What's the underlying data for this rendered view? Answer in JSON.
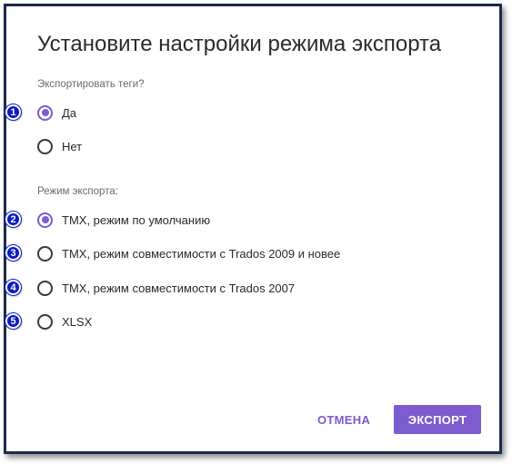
{
  "dialog": {
    "title": "Установите настройки режима экспорта"
  },
  "export_tags": {
    "label": "Экспортировать теги?",
    "options": [
      {
        "label": "Да",
        "selected": true
      },
      {
        "label": "Нет",
        "selected": false
      }
    ]
  },
  "export_mode": {
    "label": "Режим экспорта:",
    "options": [
      {
        "label": "TMX, режим по умолчанию",
        "selected": true
      },
      {
        "label": "TMX, режим совместимости с Trados 2009 и новее",
        "selected": false
      },
      {
        "label": "TMX, режим совместимости с Trados 2007",
        "selected": false
      },
      {
        "label": "XLSX",
        "selected": false
      }
    ]
  },
  "annotations": [
    "1",
    "2",
    "3",
    "4",
    "5"
  ],
  "buttons": {
    "cancel": "ОТМЕНА",
    "export": "ЭКСПОРТ"
  },
  "colors": {
    "accent": "#7c5ccf",
    "badge": "#0b1bc4",
    "frame": "#1c2b4a"
  }
}
